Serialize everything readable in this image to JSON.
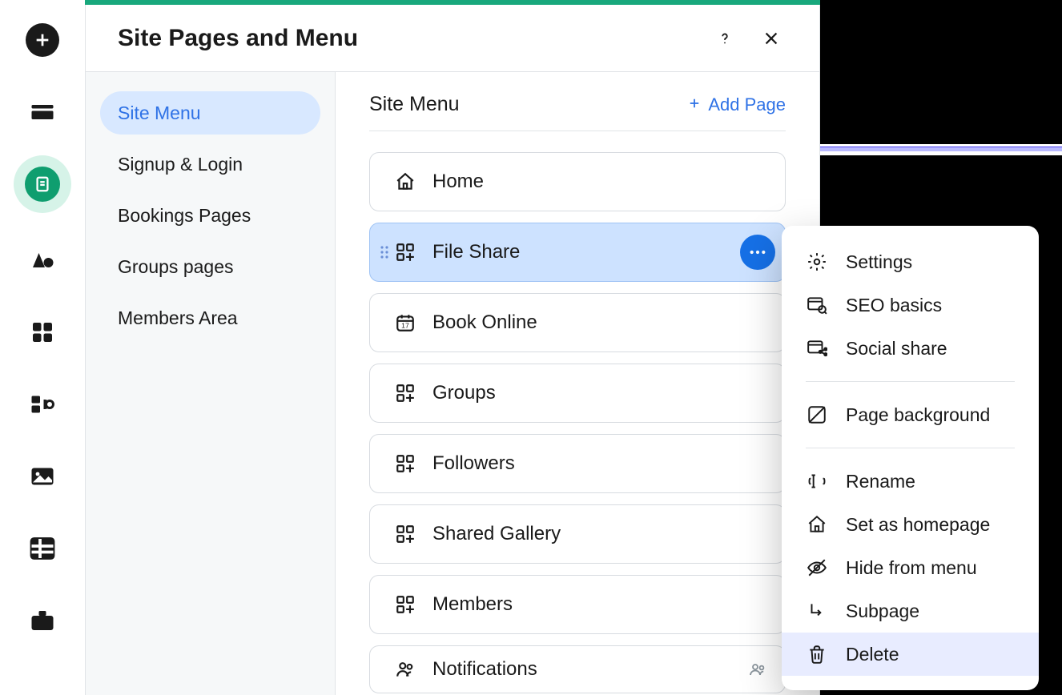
{
  "panel": {
    "title": "Site Pages and Menu"
  },
  "sidenav": {
    "items": [
      {
        "label": "Site Menu",
        "active": true
      },
      {
        "label": "Signup & Login"
      },
      {
        "label": "Bookings Pages"
      },
      {
        "label": "Groups pages"
      },
      {
        "label": "Members Area"
      }
    ]
  },
  "main": {
    "heading": "Site Menu",
    "add_page": "Add Page",
    "pages": [
      {
        "label": "Home",
        "icon": "home",
        "selected": false
      },
      {
        "label": "File Share",
        "icon": "app",
        "selected": true
      },
      {
        "label": "Book Online",
        "icon": "calendar",
        "selected": false
      },
      {
        "label": "Groups",
        "icon": "app",
        "selected": false
      },
      {
        "label": "Followers",
        "icon": "app",
        "selected": false
      },
      {
        "label": "Shared Gallery",
        "icon": "app",
        "selected": false
      },
      {
        "label": "Members",
        "icon": "app",
        "selected": false
      },
      {
        "label": "Notifications",
        "icon": "people",
        "selected": false,
        "members": true
      }
    ]
  },
  "context_menu": {
    "groups": [
      [
        {
          "label": "Settings",
          "icon": "gear"
        },
        {
          "label": "SEO basics",
          "icon": "seo"
        },
        {
          "label": "Social share",
          "icon": "social"
        }
      ],
      [
        {
          "label": "Page background",
          "icon": "background"
        }
      ],
      [
        {
          "label": "Rename",
          "icon": "rename"
        },
        {
          "label": "Set as homepage",
          "icon": "home"
        },
        {
          "label": "Hide from menu",
          "icon": "hide"
        },
        {
          "label": "Subpage",
          "icon": "subpage"
        },
        {
          "label": "Delete",
          "icon": "trash",
          "highlight": true
        }
      ]
    ]
  },
  "toolbar": {
    "items": [
      {
        "name": "add",
        "icon": "plus-circle"
      },
      {
        "name": "sections",
        "icon": "sections"
      },
      {
        "name": "pages",
        "icon": "pages",
        "active": true
      },
      {
        "name": "theme",
        "icon": "theme"
      },
      {
        "name": "apps",
        "icon": "apps"
      },
      {
        "name": "addons",
        "icon": "addons"
      },
      {
        "name": "media",
        "icon": "media"
      },
      {
        "name": "table",
        "icon": "table"
      },
      {
        "name": "business",
        "icon": "briefcase"
      }
    ]
  }
}
